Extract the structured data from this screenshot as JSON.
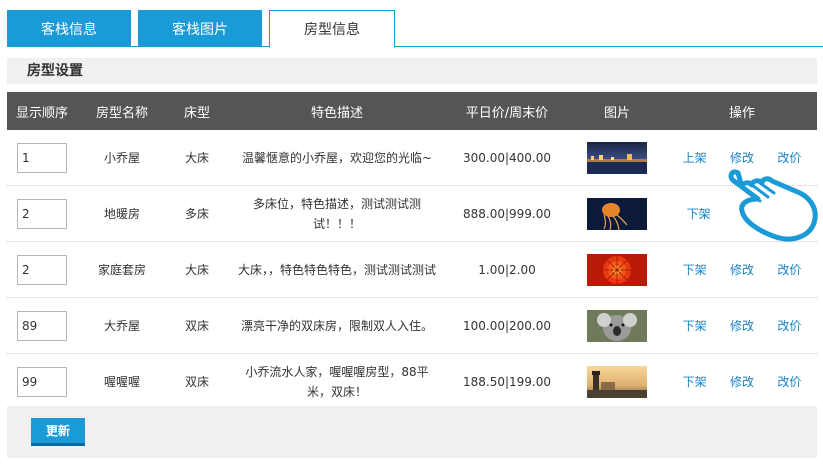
{
  "tabs": [
    {
      "label": "客栈信息"
    },
    {
      "label": "客栈图片"
    },
    {
      "label": "房型信息"
    }
  ],
  "section_title": "房型设置",
  "columns": [
    "显示顺序",
    "房型名称",
    "床型",
    "特色描述",
    "平日价/周末价",
    "图片",
    "操作"
  ],
  "rows": [
    {
      "order": "1",
      "name": "小乔屋",
      "bed": "大床",
      "desc": "温馨惬意的小乔屋，欢迎您的光临~",
      "price": "300.00|400.00",
      "image": "night-harbor",
      "status_action": "上架",
      "edit": "修改",
      "reprice": "改价"
    },
    {
      "order": "2",
      "name": "地暖房",
      "bed": "多床",
      "desc": "多床位，特色描述，测试测试测试！！！",
      "price": "888.00|999.00",
      "image": "jellyfish",
      "status_action": "下架",
      "edit": "修改",
      "reprice": ""
    },
    {
      "order": "2",
      "name": "家庭套房",
      "bed": "大床",
      "desc": "大床，，特色特色特色，测试测试测试",
      "price": "1.00|2.00",
      "image": "red-flower",
      "status_action": "下架",
      "edit": "修改",
      "reprice": "改价"
    },
    {
      "order": "89",
      "name": "大乔屋",
      "bed": "双床",
      "desc": "漂亮干净的双床房，限制双人入住。",
      "price": "100.00|200.00",
      "image": "koala",
      "status_action": "下架",
      "edit": "修改",
      "reprice": "改价"
    },
    {
      "order": "99",
      "name": "喔喔喔",
      "bed": "双床",
      "desc": "小乔流水人家，喔喔喔房型，88平米，双床！",
      "price": "188.50|199.00",
      "image": "lighthouse",
      "status_action": "下架",
      "edit": "修改",
      "reprice": "改价"
    }
  ],
  "update_label": "更新",
  "colors": {
    "accent": "#1a9bd7",
    "header_bg": "#555555",
    "link": "#1a82c4"
  }
}
